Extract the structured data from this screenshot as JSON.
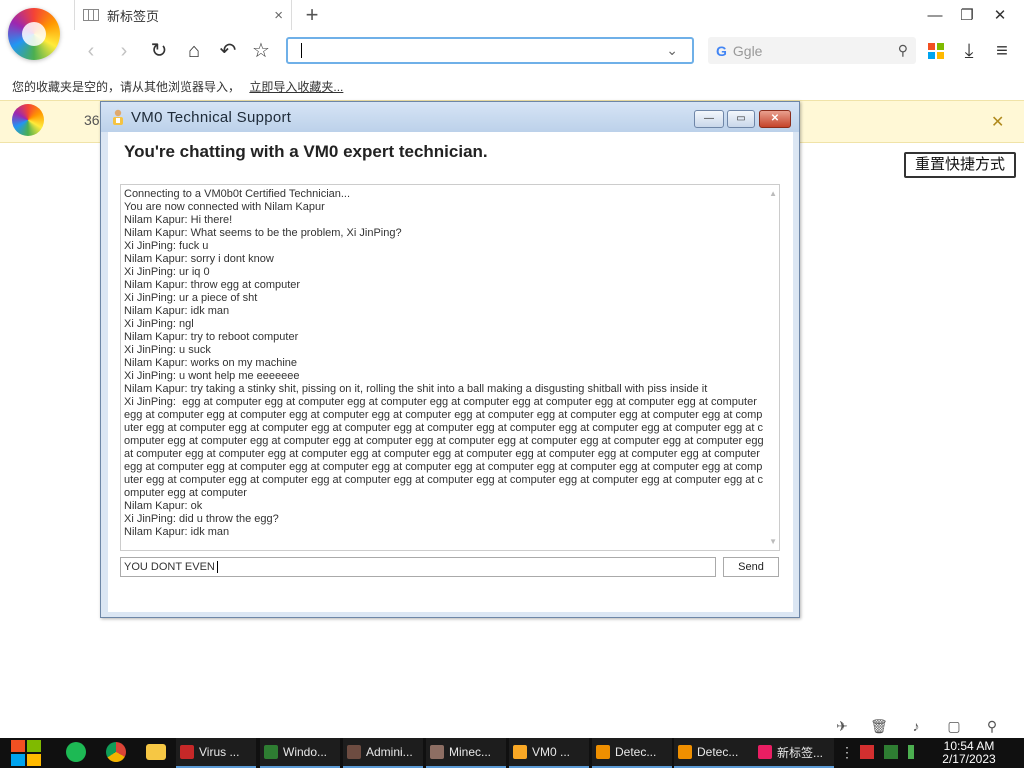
{
  "browser": {
    "tab_title": "新标签页",
    "tab_close": "×",
    "new_tab": "+",
    "window_controls": {
      "minimize": "—",
      "maximize": "❐",
      "close": "✕"
    },
    "search_placeholder": "Ggle",
    "search_engine_glyph": "G",
    "bookmark_bar_text": "您的收藏夹是空的，请从其他浏览器导入，",
    "bookmark_bar_link": "立即导入收藏夹...",
    "notice_text": "36",
    "notice_close": "✕",
    "reset_shortcuts": "重置快捷方式"
  },
  "dialog": {
    "title": "VM0 Technical Support",
    "heading": "You're chatting with a VM0 expert technician.",
    "buttons": {
      "minimize": "—",
      "maximize": "▭",
      "close": "✕"
    },
    "chat_lines": [
      "Connecting to a VM0b0t Certified Technician...",
      "You are now connected with Nilam Kapur",
      "Nilam Kapur: Hi there!",
      "Nilam Kapur: What seems to be the problem, Xi JinPing?",
      "Xi JinPing: fuck u",
      "Nilam Kapur: sorry i dont know",
      "Xi JinPing: ur iq 0",
      "Nilam Kapur: throw egg at computer",
      "Xi JinPing: ur a piece of sht",
      "Nilam Kapur: idk man",
      "Xi JinPing: ngl",
      "Nilam Kapur: try to reboot computer",
      "Xi JinPing: u suck",
      "Nilam Kapur: works on my machine",
      "Xi JinPing: u wont help me eeeeeee",
      "Nilam Kapur: try taking a stinky shit, pissing on it, rolling the shit into a ball making a disgusting shitball with piss inside it",
      "Xi JinPing:  egg at computer egg at computer egg at computer egg at computer egg at computer egg at computer egg at computer egg at computer egg at computer egg at computer egg at computer egg at computer egg at computer egg at computer egg at computer egg at computer egg at computer egg at computer egg at computer egg at computer egg at computer egg at computer egg at computer egg at computer egg at computer egg at computer egg at computer egg at computer egg at computer egg at computer egg at computer egg at computer egg at computer egg at computer egg at computer egg at computer egg at computer egg at computer egg at computer egg at computer egg at computer egg at computer egg at computer egg at computer egg at computer egg at computer egg at computer egg at computer egg at computer egg at computer egg at computer egg at computer egg at computer egg at computer egg at computer",
      "Nilam Kapur: ok",
      "Xi JinPing: did u throw the egg?",
      "Nilam Kapur: idk man"
    ],
    "input_value": "YOU DONT EVEN",
    "send_label": "Send"
  },
  "taskbar": {
    "items": [
      {
        "label": "Virus ...",
        "color": "#c62828"
      },
      {
        "label": "Windo...",
        "color": "#2e7d32"
      },
      {
        "label": "Admini...",
        "color": "#6d4c41"
      },
      {
        "label": "Minec...",
        "color": "#8d6e63"
      },
      {
        "label": "VM0 ...",
        "color": "#f9a825"
      },
      {
        "label": "Detec...",
        "color": "#ef8f00"
      },
      {
        "label": "Detec...",
        "color": "#ef8f00"
      },
      {
        "label": "新标签...",
        "color": "#e91e63"
      }
    ],
    "time": "10:54 AM",
    "date": "2/17/2023"
  },
  "colors": {
    "accent": "#6fb0e8",
    "notice_bg": "#fff8d6",
    "taskbar_bg": "#101010",
    "dialog_frame": "#dbe6f3"
  }
}
